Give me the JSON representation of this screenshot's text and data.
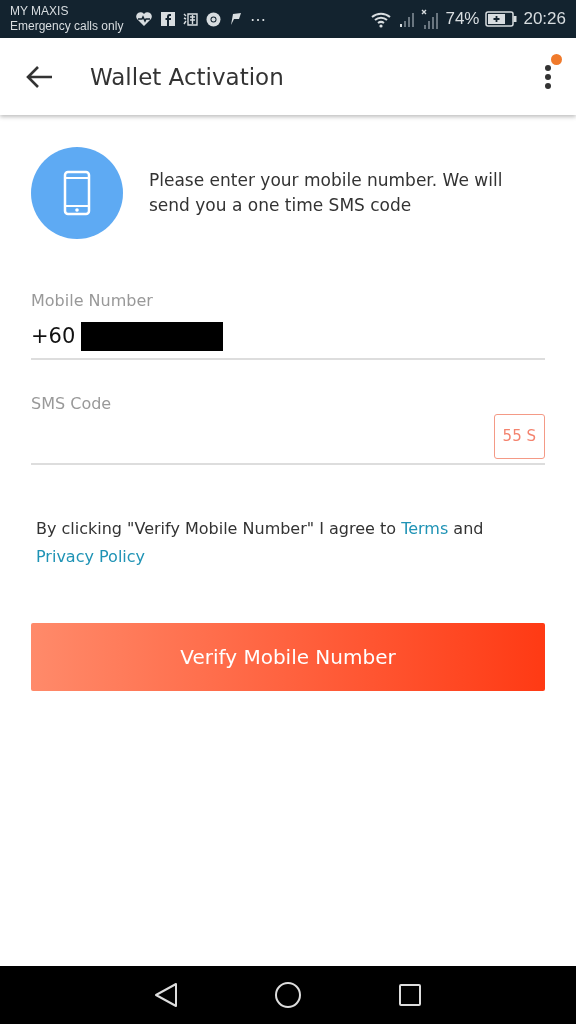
{
  "status_bar": {
    "carrier": "MY MAXIS",
    "network_note": "Emergency calls only",
    "battery": "74%",
    "time": "20:26",
    "overflow": "⋯"
  },
  "app_bar": {
    "title": "Wallet Activation",
    "menu_badge": true
  },
  "intro": {
    "text": "Please enter your mobile number. We will send you a one time SMS code"
  },
  "fields": [
    {
      "kind": "phone",
      "label": "Mobile Number",
      "value": "+60",
      "redacted": true
    },
    {
      "kind": "code",
      "label": "SMS Code",
      "countdown": "55 S"
    }
  ],
  "consent": {
    "before": "By clicking \"Verify Mobile Number\" I agree to",
    "terms_link": "Terms",
    "middle": "and",
    "privacy_link": "Privacy Policy"
  },
  "primary_button": {
    "label": "Verify Mobile Number"
  }
}
